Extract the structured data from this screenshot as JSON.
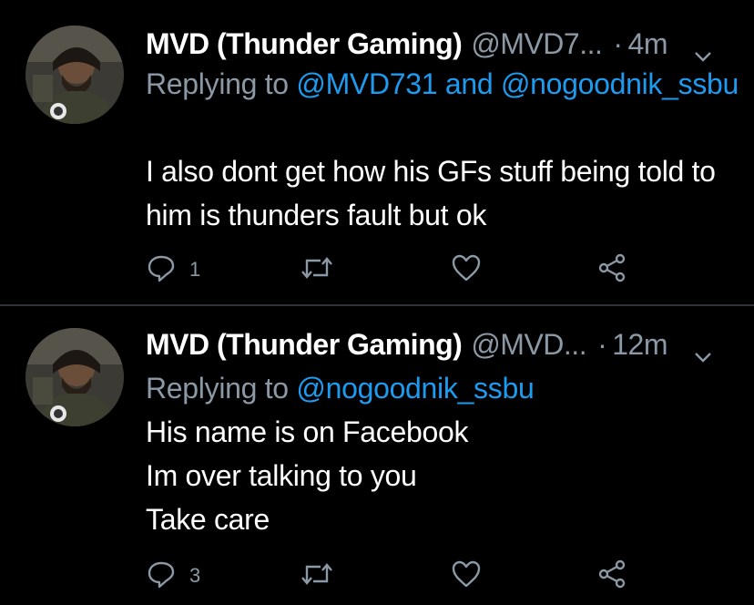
{
  "tweets": [
    {
      "author_name": "MVD (Thunder Gaming)",
      "handle": "@MVD7...",
      "separator": "·",
      "time": "4m",
      "replying_prefix": "Replying to ",
      "replying_mentions": "@MVD731 and @nogoodnik_ssbu",
      "text": "I also dont get how his GFs stuff being told to him is thunders fault but ok",
      "reply_count": "1",
      "retweet_count": "",
      "like_count": ""
    },
    {
      "author_name": "MVD (Thunder Gaming)",
      "handle": "@MVD...",
      "separator": "·",
      "time": "12m",
      "replying_prefix": "Replying to ",
      "replying_mentions": "@nogoodnik_ssbu",
      "text_lines": [
        "His name is on Facebook",
        "Im over talking to you",
        "Take care"
      ],
      "reply_count": "3",
      "retweet_count": "",
      "like_count": ""
    }
  ],
  "colors": {
    "background": "#000000",
    "text": "#ffffff",
    "secondary": "#8b98a5",
    "mention": "#1d9bf0",
    "divider": "#2f3336"
  },
  "icons": [
    "reply-icon",
    "retweet-icon",
    "like-icon",
    "share-icon",
    "chevron-down-icon"
  ]
}
